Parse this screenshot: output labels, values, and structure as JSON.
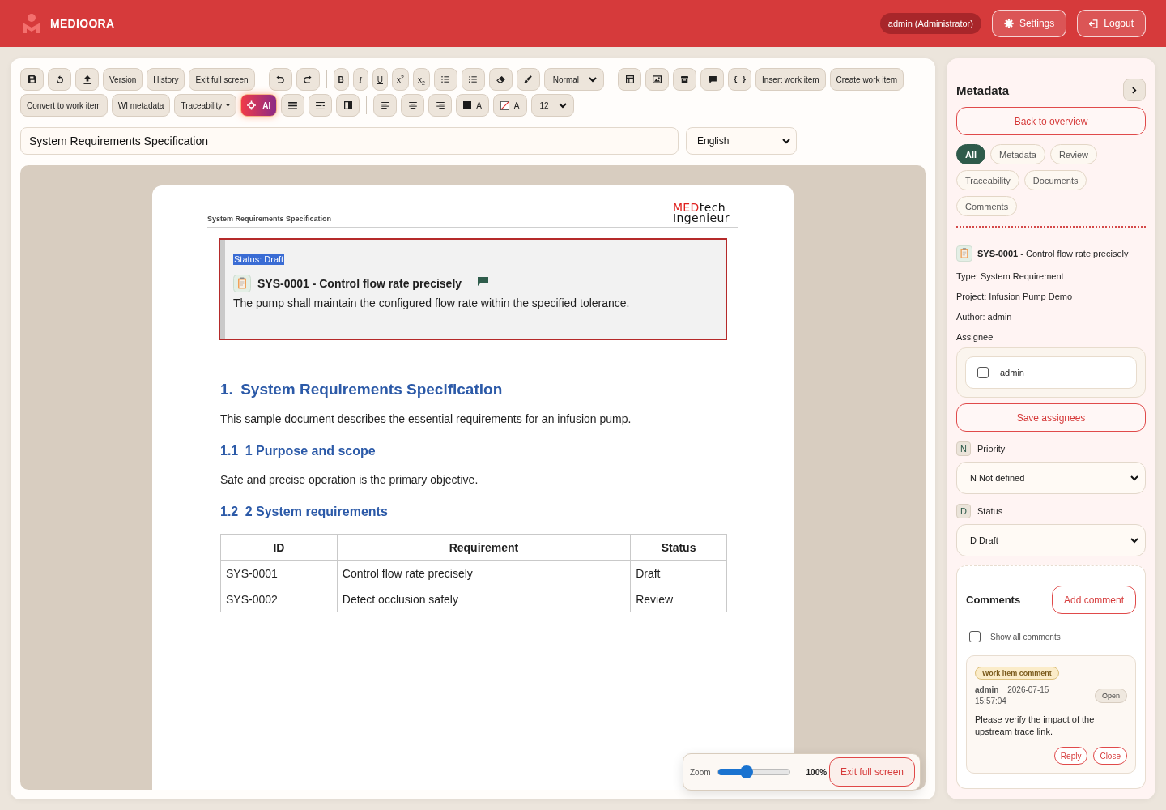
{
  "header": {
    "brand": "MEDIOORA",
    "user_badge": "admin (Administrator)",
    "buttons": [
      {
        "kind": "settings",
        "label": "Settings"
      },
      {
        "kind": "logout",
        "label": "Logout"
      }
    ]
  },
  "toolbar": {
    "rows": [
      {
        "items": [
          {
            "kind": "save"
          },
          {
            "kind": "reset"
          },
          {
            "kind": "upload"
          },
          {
            "kind": "text",
            "label": "Version"
          },
          {
            "kind": "text",
            "label": "History"
          },
          {
            "kind": "text",
            "label": "Exit full screen"
          },
          {
            "kind": "divider"
          },
          {
            "kind": "undo"
          },
          {
            "kind": "redo"
          },
          {
            "kind": "divider"
          },
          {
            "kind": "bold",
            "label": "B"
          },
          {
            "kind": "italic",
            "label": "I"
          },
          {
            "kind": "underline",
            "label": "U"
          },
          {
            "kind": "superscript",
            "label": "x$^{2}$"
          },
          {
            "kind": "subscript",
            "label": "x$_{2}$"
          },
          {
            "kind": "bullets"
          },
          {
            "kind": "numbering"
          },
          {
            "kind": "eraser"
          },
          {
            "kind": "brush"
          },
          {
            "kind": "select",
            "value": "Normal"
          },
          {
            "kind": "divider"
          },
          {
            "kind": "table"
          },
          {
            "kind": "image"
          },
          {
            "kind": "archive"
          },
          {
            "kind": "comment"
          },
          {
            "kind": "code",
            "label": "{ }"
          },
          {
            "kind": "text",
            "label": "Insert work item"
          },
          {
            "kind": "text",
            "label": "Create work item"
          }
        ]
      },
      {
        "items": [
          {
            "kind": "text",
            "label": "Convert to work item"
          },
          {
            "kind": "text",
            "label": "WI metadata"
          },
          {
            "kind": "dropdown",
            "label": "Traceability"
          },
          {
            "kind": "ai",
            "label": "AI"
          },
          {
            "kind": "lines"
          },
          {
            "kind": "indent"
          },
          {
            "kind": "half"
          },
          {
            "kind": "divider"
          },
          {
            "kind": "left"
          },
          {
            "kind": "center"
          },
          {
            "kind": "right"
          },
          {
            "kind": "fontcolor",
            "label": "A"
          },
          {
            "kind": "highlight",
            "label": "A"
          },
          {
            "kind": "select",
            "value": "12"
          }
        ]
      }
    ]
  },
  "title_field": {
    "value": "System Requirements Specification"
  },
  "language_select": {
    "value": "English"
  },
  "document": {
    "page_title": "System Requirements Specification",
    "logo": {
      "accent": "MED",
      "rest": "tech",
      "second_line": "Ingenieur"
    },
    "work_item": {
      "status": {
        "text": "Status: Draft",
        "highlighted": true
      },
      "title": "SYS-0001 - Control flow rate precisely",
      "comment_flag": true,
      "description": "The pump shall maintain the configured flow rate within the specified tolerance."
    },
    "blocks": [
      {
        "kind": "h1",
        "number": "1.",
        "text": "System Requirements Specification"
      },
      {
        "kind": "paragraph",
        "text": "This sample document describes the essential requirements for an infusion pump."
      },
      {
        "kind": "h2",
        "number": "1.1",
        "text": "1 Purpose and scope"
      },
      {
        "kind": "paragraph",
        "text": "Safe and precise operation is the primary objective."
      },
      {
        "kind": "h2",
        "number": "1.2",
        "text": "2 System requirements"
      },
      {
        "kind": "table",
        "columns": [
          "ID",
          "Requirement",
          "Status"
        ],
        "rows": [
          [
            "SYS-0001",
            "Control flow rate precisely",
            "Draft"
          ],
          [
            "SYS-0002",
            "Detect occlusion safely",
            "Review"
          ]
        ]
      }
    ]
  },
  "zoom_bar": {
    "label": "Zoom",
    "level": 0.4,
    "reading": "100%",
    "button": "Exit full screen"
  },
  "sidebar": {
    "title": "Metadata",
    "back_button": "Back to overview",
    "filters": [
      {
        "label": "All",
        "selected": true
      },
      {
        "label": "Metadata",
        "selected": false
      },
      {
        "label": "Review",
        "selected": false
      },
      {
        "label": "Traceability",
        "selected": false
      },
      {
        "label": "Documents",
        "selected": false
      },
      {
        "label": "Comments",
        "selected": false
      }
    ],
    "item_title": "**SYS-0001** - Control flow rate precisely",
    "fields": [
      "Type: System Requirement",
      "Project: Infusion Pump Demo",
      "Author: admin"
    ],
    "assignee": {
      "label": "Assignee",
      "options": [
        {
          "name": "admin",
          "checked": false
        }
      ],
      "save_button": "Save assignees"
    },
    "selects": [
      {
        "badge": "N",
        "label": "Priority",
        "value": "N Not defined"
      },
      {
        "badge": "D",
        "label": "Status",
        "value": "D Draft"
      }
    ],
    "comments": {
      "title": "Comments",
      "add_button": "Add comment",
      "show_all": {
        "label": "Show all comments",
        "checked": false
      },
      "items": [
        {
          "tag": "Work item comment",
          "author": "admin",
          "time": "2026-07-15 15:57:04",
          "state": "Open",
          "text": "Please verify the impact of the upstream trace link.",
          "actions": [
            "Reply",
            "Close"
          ]
        }
      ]
    }
  }
}
